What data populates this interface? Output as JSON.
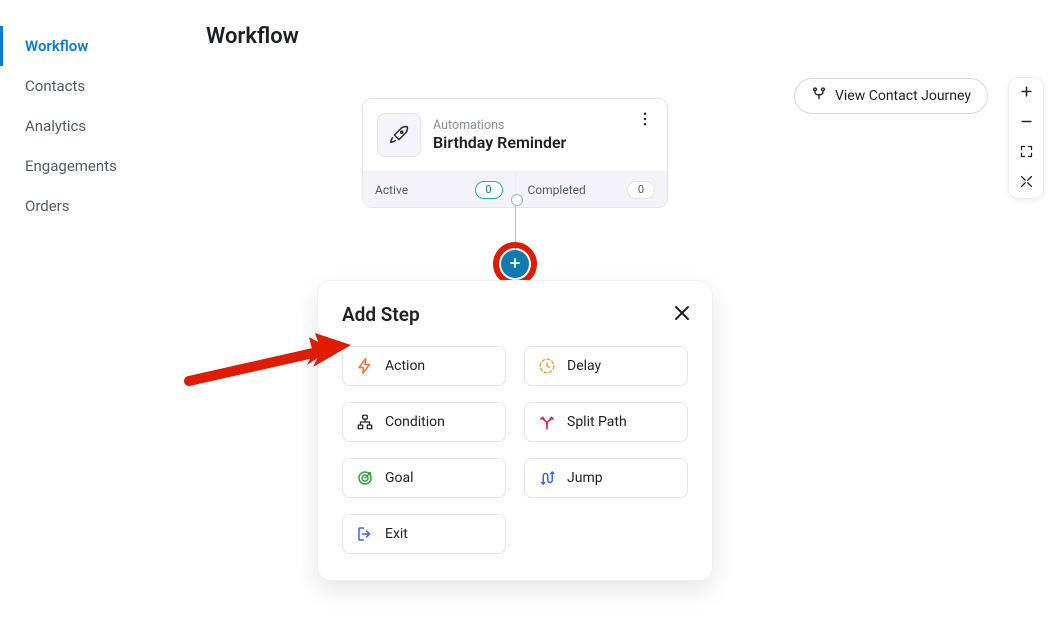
{
  "sidebar": {
    "items": [
      {
        "label": "Workflow",
        "active": true
      },
      {
        "label": "Contacts",
        "active": false
      },
      {
        "label": "Analytics",
        "active": false
      },
      {
        "label": "Engagements",
        "active": false
      },
      {
        "label": "Orders",
        "active": false
      }
    ]
  },
  "header": {
    "title": "Workflow"
  },
  "toolbar": {
    "journey_button": "View Contact Journey"
  },
  "workflow_card": {
    "subtitle": "Automations",
    "title": "Birthday Reminder",
    "active_label": "Active",
    "active_count": "0",
    "completed_label": "Completed",
    "completed_count": "0"
  },
  "add_step": {
    "title": "Add Step",
    "options": {
      "action": "Action",
      "delay": "Delay",
      "condition": "Condition",
      "split_path": "Split Path",
      "goal": "Goal",
      "jump": "Jump",
      "exit": "Exit"
    }
  },
  "colors": {
    "accent": "#0a7dd3",
    "action_icon": "#f4743b",
    "delay_icon": "#f2a33c",
    "split_icon": "#e11b5a",
    "goal_icon": "#2fa63e",
    "jump_icon": "#3a62f0",
    "exit_icon": "#3a62f0",
    "annotation_red": "#e11b00"
  }
}
